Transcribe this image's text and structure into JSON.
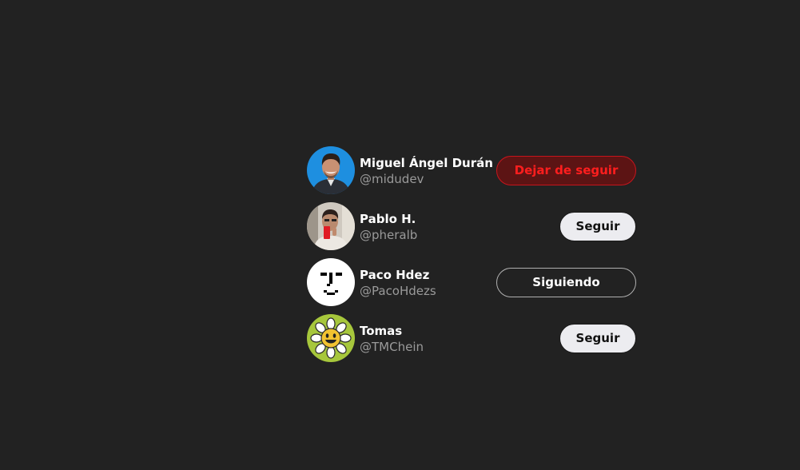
{
  "users": [
    {
      "name": "Miguel Ángel Durán",
      "handle": "@midudev",
      "button_label": "Dejar de seguir",
      "button_state": "unfollow-hover"
    },
    {
      "name": "Pablo H.",
      "handle": "@pheralb",
      "button_label": "Seguir",
      "button_state": "follow"
    },
    {
      "name": "Paco Hdez",
      "handle": "@PacoHdezs",
      "button_label": "Siguiendo",
      "button_state": "following"
    },
    {
      "name": "Tomas",
      "handle": "@TMChein",
      "button_label": "Seguir",
      "button_state": "follow"
    }
  ],
  "colors": {
    "background": "#222222",
    "unfollow_text": "#ff1e1e",
    "unfollow_bg": "#5c1414",
    "follow_bg": "#ececf0",
    "handle_text": "#9a9a9a"
  }
}
